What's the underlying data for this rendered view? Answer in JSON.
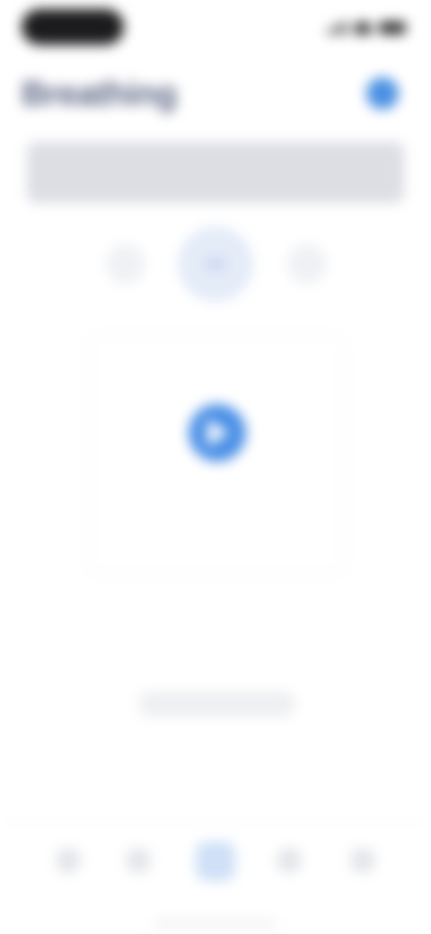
{
  "status_bar": {
    "time": ""
  },
  "header": {
    "title": "Breathing",
    "action_icon": "plus-icon"
  },
  "banner": {
    "text": ""
  },
  "mode_selector": {
    "left_icon": "wave-icon",
    "center_icon": "microphone-icon",
    "right_icon": "waveform-icon"
  },
  "record_card": {
    "play_icon": "play-icon",
    "label": ""
  },
  "prompt": {
    "text": "",
    "button_label": ""
  },
  "tab_bar": {
    "tabs": [
      {
        "label": "",
        "icon": "home-icon"
      },
      {
        "label": "",
        "icon": "list-icon"
      },
      {
        "label": "",
        "icon": "record-icon"
      },
      {
        "label": "",
        "icon": "chart-icon"
      },
      {
        "label": "",
        "icon": "profile-icon"
      }
    ],
    "active_index": 2
  },
  "colors": {
    "accent": "#4a8fe6",
    "title": "#5a6482",
    "banner_bg": "#dcdee4",
    "active_tab_bg": "#cfe0f7"
  }
}
